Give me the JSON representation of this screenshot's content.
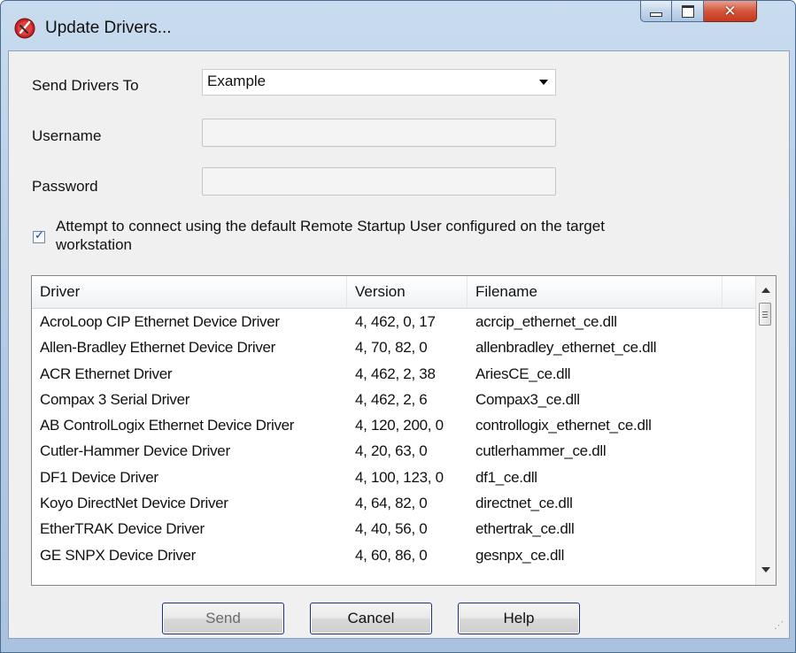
{
  "window": {
    "title": "Update Drivers..."
  },
  "form": {
    "send_to_label": "Send Drivers To",
    "send_to_value": "Example",
    "username_label": "Username",
    "username_value": "",
    "password_label": "Password",
    "password_value": "",
    "checkbox_checked": true,
    "checkbox_label": "Attempt to connect using the default Remote Startup User configured on the target workstation"
  },
  "list": {
    "columns": [
      "Driver",
      "Version",
      "Filename"
    ],
    "rows": [
      [
        "AcroLoop CIP Ethernet Device Driver",
        "4, 462, 0, 17",
        "acrcip_ethernet_ce.dll"
      ],
      [
        "Allen-Bradley Ethernet Device Driver",
        "4, 70, 82, 0",
        "allenbradley_ethernet_ce.dll"
      ],
      [
        "ACR Ethernet Driver",
        "4, 462, 2, 38",
        "AriesCE_ce.dll"
      ],
      [
        "Compax 3 Serial Driver",
        "4, 462, 2, 6",
        "Compax3_ce.dll"
      ],
      [
        "AB ControlLogix Ethernet Device Driver",
        "4, 120, 200, 0",
        "controllogix_ethernet_ce.dll"
      ],
      [
        "Cutler-Hammer Device Driver",
        "4, 20, 63, 0",
        "cutlerhammer_ce.dll"
      ],
      [
        "DF1 Device Driver",
        "4, 100, 123, 0",
        "df1_ce.dll"
      ],
      [
        "Koyo DirectNet Device Driver",
        "4, 64, 82, 0",
        "directnet_ce.dll"
      ],
      [
        "EtherTRAK Device Driver",
        "4, 40, 56, 0",
        "ethertrak_ce.dll"
      ],
      [
        "GE SNPX Device Driver",
        "4, 60, 86, 0",
        "gesnpx_ce.dll"
      ]
    ]
  },
  "buttons": {
    "send": "Send",
    "cancel": "Cancel",
    "help": "Help"
  },
  "icons": {
    "app": "application-icon",
    "minimize": "minimize-icon",
    "maximize": "maximize-icon",
    "close": "close-icon"
  }
}
